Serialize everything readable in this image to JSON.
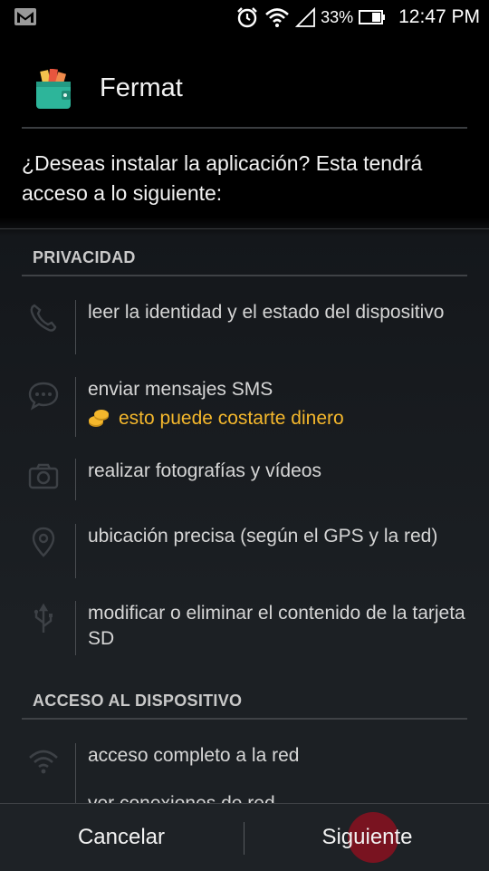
{
  "status_bar": {
    "battery_pct": "33%",
    "time": "12:47 PM"
  },
  "app": {
    "name": "Fermat"
  },
  "prompt": {
    "question": "¿Deseas instalar la aplicación? Esta tendrá acceso a lo siguiente:"
  },
  "sections": [
    {
      "title": "PRIVACIDAD",
      "items": [
        {
          "icon": "phone-icon",
          "text": "leer la identidad y el estado del dispositivo"
        },
        {
          "icon": "chat-bubble-icon",
          "text": "enviar mensajes SMS",
          "warning": "esto puede costarte dinero"
        },
        {
          "icon": "camera-icon",
          "text": "realizar fotografías y vídeos"
        },
        {
          "icon": "location-pin-icon",
          "text": "ubicación precisa (según el GPS y la red)"
        },
        {
          "icon": "usb-icon",
          "text": "modificar o eliminar el contenido de la tarjeta SD"
        }
      ]
    },
    {
      "title": "ACCESO AL DISPOSITIVO",
      "items": [
        {
          "icon": "wifi-icon",
          "text": "acceso completo a la red"
        },
        {
          "text": "ver conexiones de red"
        }
      ]
    }
  ],
  "buttons": {
    "cancel": "Cancelar",
    "next": "Siguiente"
  },
  "colors": {
    "warning": "#f4b72c",
    "touch_indicator": "#8a1020"
  }
}
